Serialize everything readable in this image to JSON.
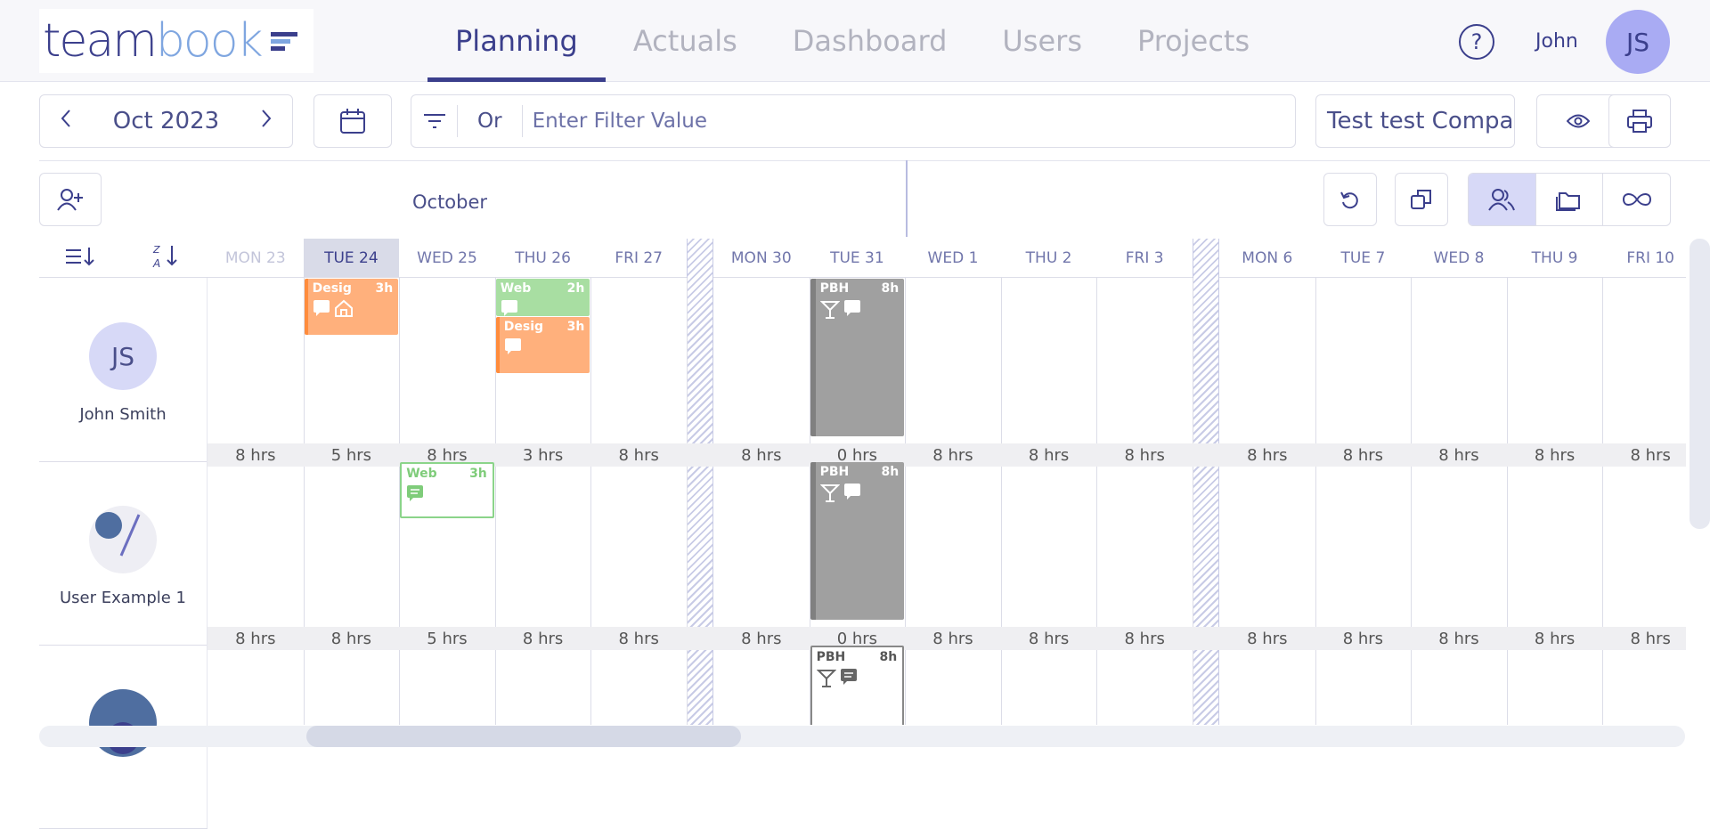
{
  "header": {
    "logo": {
      "part1": "team",
      "part2": "book"
    },
    "tabs": [
      {
        "label": "Planning",
        "active": true
      },
      {
        "label": "Actuals"
      },
      {
        "label": "Dashboard"
      },
      {
        "label": "Users"
      },
      {
        "label": "Projects"
      }
    ],
    "help": "?",
    "user_name": "John",
    "user_initials": "JS"
  },
  "toolbar": {
    "month": "Oct 2023",
    "filter_mode": "Or",
    "filter_placeholder": "Enter Filter Value",
    "company": "Test test Company"
  },
  "calendar": {
    "month_label": "October",
    "days": [
      {
        "label": "MON 23",
        "style": "dim"
      },
      {
        "label": "TUE 24",
        "style": "today"
      },
      {
        "label": "WED 25"
      },
      {
        "label": "THU 26"
      },
      {
        "label": "FRI 27"
      },
      {
        "label": "MON 30"
      },
      {
        "label": "TUE 31"
      },
      {
        "label": "WED 1"
      },
      {
        "label": "THU 2"
      },
      {
        "label": "FRI 3"
      },
      {
        "label": "MON 6"
      },
      {
        "label": "TUE 7"
      },
      {
        "label": "WED 8"
      },
      {
        "label": "THU 9"
      },
      {
        "label": "FRI 10"
      }
    ]
  },
  "users": [
    {
      "name": "John Smith",
      "initials": "JS",
      "hours": [
        "8 hrs",
        "5 hrs",
        "8 hrs",
        "3 hrs",
        "8 hrs",
        "8 hrs",
        "0 hrs",
        "8 hrs",
        "8 hrs",
        "8 hrs",
        "8 hrs",
        "8 hrs",
        "8 hrs",
        "8 hrs",
        "8 hrs"
      ]
    },
    {
      "name": "User Example 1",
      "initials": "",
      "hours": [
        "8 hrs",
        "8 hrs",
        "5 hrs",
        "8 hrs",
        "8 hrs",
        "8 hrs",
        "0 hrs",
        "8 hrs",
        "8 hrs",
        "8 hrs",
        "8 hrs",
        "8 hrs",
        "8 hrs",
        "8 hrs",
        "8 hrs"
      ]
    },
    {
      "name": "",
      "initials": "",
      "hours": []
    }
  ],
  "tasks": [
    {
      "name": "Desig",
      "hours": "3h",
      "user": 0,
      "day": 1,
      "style": "orange",
      "icons": [
        "comment-icon",
        "home-icon"
      ]
    },
    {
      "name": "Web",
      "hours": "2h",
      "user": 0,
      "day": 3,
      "style": "green",
      "icons": [
        "comment-icon"
      ]
    },
    {
      "name": "Desig",
      "hours": "3h",
      "user": 0,
      "day": 3,
      "style": "orange",
      "icons": [
        "comment-icon"
      ]
    },
    {
      "name": "PBH",
      "hours": "8h",
      "user": 0,
      "day": 6,
      "style": "gray",
      "icons": [
        "cocktail-icon",
        "comment-icon"
      ]
    },
    {
      "name": "Web",
      "hours": "3h",
      "user": 1,
      "day": 2,
      "style": "greeno",
      "icons": [
        "comment-icon"
      ]
    },
    {
      "name": "PBH",
      "hours": "8h",
      "user": 1,
      "day": 6,
      "style": "gray",
      "icons": [
        "cocktail-icon",
        "comment-icon"
      ]
    },
    {
      "name": "PBH",
      "hours": "8h",
      "user": 2,
      "day": 6,
      "style": "grayo",
      "icons": [
        "cocktail-icon",
        "comment-icon"
      ]
    }
  ],
  "colors": {
    "primary": "#3b3f8c",
    "accent": "#a9abf3",
    "orange": "#ffb07c",
    "green": "#a8dea2",
    "gray": "#a0a0a0"
  }
}
